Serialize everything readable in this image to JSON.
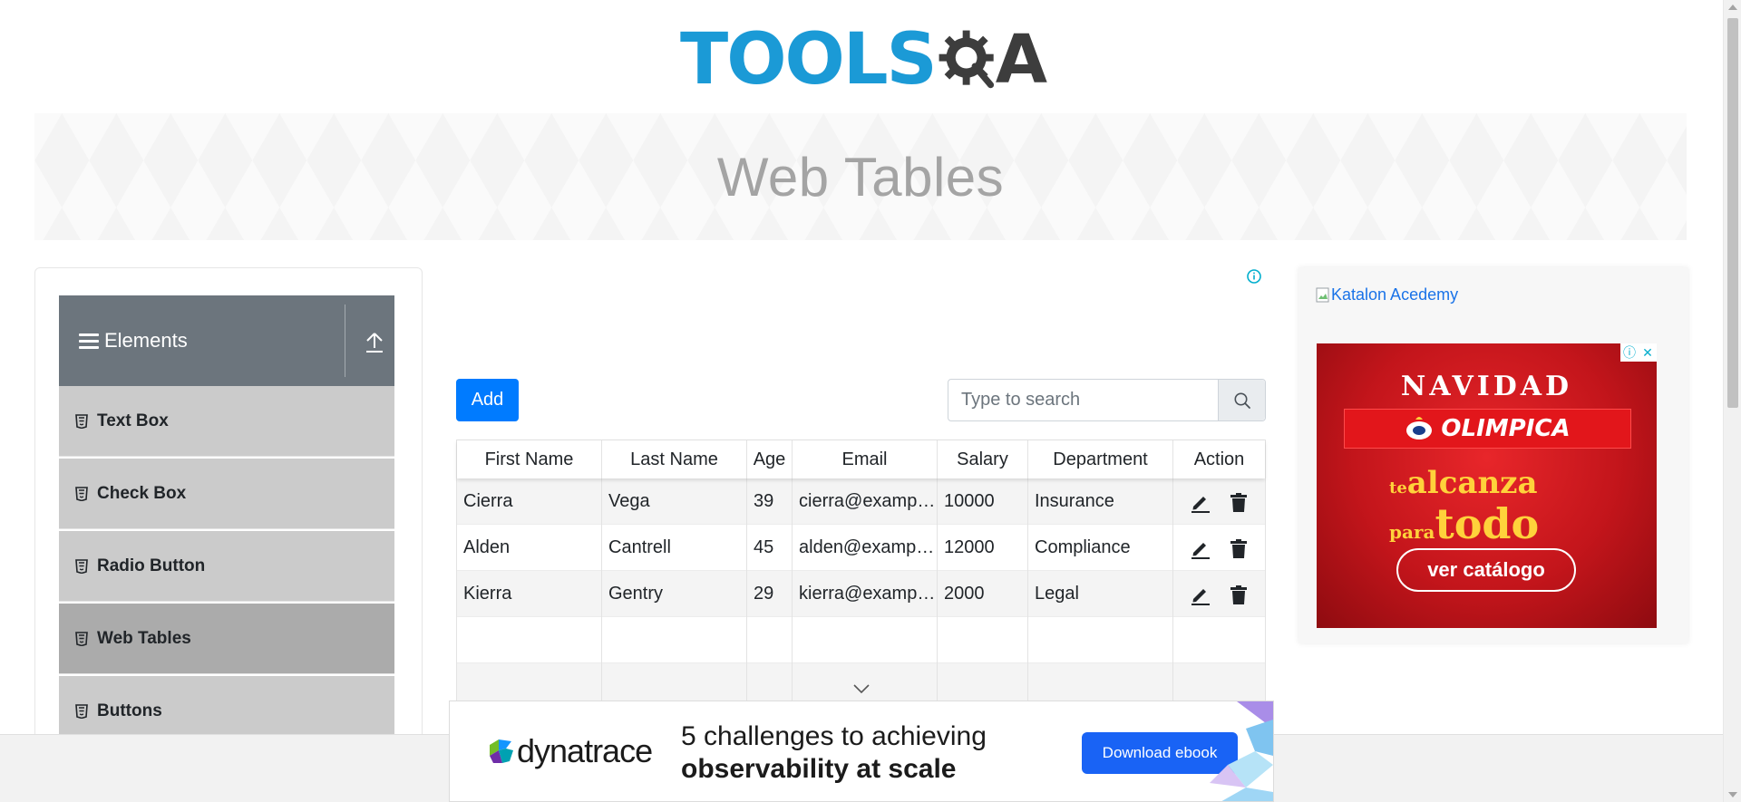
{
  "header": {
    "logo_main": "TOOLS",
    "logo_tail": "A"
  },
  "banner": {
    "title": "Web Tables"
  },
  "sidebar": {
    "group_title": "Elements",
    "items": [
      {
        "label": "Text Box"
      },
      {
        "label": "Check Box"
      },
      {
        "label": "Radio Button"
      },
      {
        "label": "Web Tables",
        "active": true
      },
      {
        "label": "Buttons"
      }
    ]
  },
  "toolbar": {
    "add_label": "Add",
    "search_placeholder": "Type to search"
  },
  "table": {
    "columns": [
      "First Name",
      "Last Name",
      "Age",
      "Email",
      "Salary",
      "Department",
      "Action"
    ],
    "rows": [
      [
        "Cierra",
        "Vega",
        "39",
        "cierra@example.com",
        "10000",
        "Insurance"
      ],
      [
        "Alden",
        "Cantrell",
        "45",
        "alden@example.com",
        "12000",
        "Compliance"
      ],
      [
        "Kierra",
        "Gentry",
        "29",
        "kierra@example.com",
        "2000",
        "Legal"
      ]
    ]
  },
  "right_ad": {
    "broken_image_alt": "Katalon Acedemy",
    "headline": "NAVIDAD",
    "brand": "OLIMPICA",
    "slogan_line1_small": "te",
    "slogan_line1": "alcanza",
    "slogan_line2_small": "para",
    "slogan_line2": "todo",
    "button": "ver catálogo"
  },
  "bottom_ad": {
    "brand": "dynatrace",
    "headline_line1": "5 challenges to achieving",
    "headline_line2": "observability at scale",
    "button": "Download ebook"
  },
  "colors": {
    "logo_blue": "#1b9ad6",
    "logo_dark": "#3d3d3d",
    "primary": "#007bff",
    "sidebar_header": "#6c757d",
    "menu_item": "#cbcbcb",
    "menu_item_active": "#ababab",
    "ad_red": "#c3151b",
    "dynatrace_button": "#1963f5"
  },
  "icons": {
    "menu": "hamburger-icon",
    "collapse": "upload-icon",
    "menu_item": "html5-icon",
    "search": "search-icon",
    "edit": "pencil-icon",
    "delete": "trash-icon",
    "info": "info-icon",
    "scroll_hint": "chevron-down-icon"
  }
}
